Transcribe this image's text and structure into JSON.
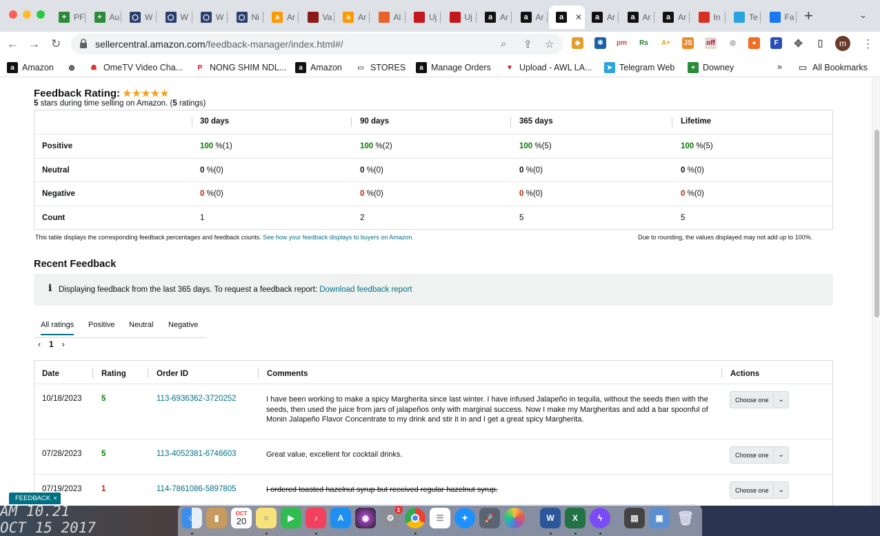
{
  "browser": {
    "tabs": [
      {
        "icon": "green-plus-icon",
        "label": "PF",
        "color": "#2c8a3b"
      },
      {
        "icon": "green-plus-icon",
        "label": "Au",
        "color": "#2c8a3b"
      },
      {
        "icon": "cube-icon",
        "label": "W",
        "color": "#2a3f6e"
      },
      {
        "icon": "cube-icon",
        "label": "W",
        "color": "#2a3f6e"
      },
      {
        "icon": "cube-icon",
        "label": "W",
        "color": "#2a3f6e"
      },
      {
        "icon": "cube-icon",
        "label": "Ni",
        "color": "#2a3f6e"
      },
      {
        "icon": "amazon-icon",
        "label": "Ar",
        "color": "#ff9900"
      },
      {
        "icon": "vv-icon",
        "label": "Va",
        "color": "#8b1a1a"
      },
      {
        "icon": "amazon-icon",
        "label": "Ar",
        "color": "#ff9900"
      },
      {
        "icon": "pen-icon",
        "label": "Al",
        "color": "#e8622c"
      },
      {
        "icon": "v-logo-icon",
        "label": "Uj",
        "color": "#c4161c"
      },
      {
        "icon": "v-logo-icon",
        "label": "Uj",
        "color": "#c4161c"
      },
      {
        "icon": "amazon-a-icon",
        "label": "Ar",
        "color": "#111"
      },
      {
        "icon": "amazon-a-icon",
        "label": "Ar",
        "color": "#111"
      },
      {
        "icon": "amazon-a-icon",
        "label": "",
        "color": "#111",
        "active": true
      },
      {
        "icon": "amazon-a-icon",
        "label": "Ar",
        "color": "#111"
      },
      {
        "icon": "amazon-a-icon",
        "label": "Ar",
        "color": "#111"
      },
      {
        "icon": "amazon-a-icon",
        "label": "Ar",
        "color": "#111"
      },
      {
        "icon": "gmail-icon",
        "label": "In",
        "color": "#d93025"
      },
      {
        "icon": "telegram-icon",
        "label": "Te",
        "color": "#2aa3df"
      },
      {
        "icon": "facebook-icon",
        "label": "Fa",
        "color": "#1877f2"
      }
    ],
    "url_host": "sellercentral.amazon.com",
    "url_path": "/feedback-manager/index.html#/",
    "profile_initial": "m",
    "bookmarks": [
      {
        "label": "Amazon",
        "icon": "amazon-a-icon"
      },
      {
        "label": "",
        "icon": "globe-icon"
      },
      {
        "label": "OmeTV Video Cha...",
        "icon": "ometv-icon"
      },
      {
        "label": "NONG SHIM NDL...",
        "icon": "pinterest-icon"
      },
      {
        "label": "Amazon",
        "icon": "amazon-a-icon"
      },
      {
        "label": "STORES",
        "icon": "folder-icon"
      },
      {
        "label": "Manage Orders",
        "icon": "amazon-a-icon"
      },
      {
        "label": "Upload - AWL LA...",
        "icon": "v-logo-icon"
      },
      {
        "label": "Telegram Web",
        "icon": "telegram-icon"
      },
      {
        "label": "Downey",
        "icon": "green-plus-icon"
      }
    ],
    "bookmarks_overflow": "»",
    "all_bookmarks": "All Bookmarks"
  },
  "feedback_rating": {
    "title": "Feedback Rating:",
    "stars": "★★★★★",
    "summary_count": "5",
    "summary_mid": " stars during time selling on Amazon. (",
    "summary_ratings": "5",
    "summary_end": " ratings)",
    "columns": [
      "30 days",
      "90 days",
      "365 days",
      "Lifetime"
    ],
    "rows": [
      {
        "label": "Positive",
        "kind": "green",
        "cells": [
          [
            "100",
            " %(1)"
          ],
          [
            "100",
            " %(2)"
          ],
          [
            "100",
            " %(5)"
          ],
          [
            "100",
            " %(5)"
          ]
        ]
      },
      {
        "label": "Neutral",
        "kind": "plain",
        "cells": [
          [
            "0",
            " %(0)"
          ],
          [
            "0",
            " %(0)"
          ],
          [
            "0",
            " %(0)"
          ],
          [
            "0",
            " %(0)"
          ]
        ]
      },
      {
        "label": "Negative",
        "kind": "red",
        "cells": [
          [
            "0",
            " %(0)"
          ],
          [
            "0",
            " %(0)"
          ],
          [
            "0",
            " %(0)"
          ],
          [
            "0",
            " %(0)"
          ]
        ]
      },
      {
        "label": "Count",
        "kind": "count",
        "cells": [
          [
            "1",
            ""
          ],
          [
            "2",
            ""
          ],
          [
            "5",
            ""
          ],
          [
            "5",
            ""
          ]
        ]
      }
    ],
    "footnote": "This table displays the corresponding feedback percentages and feedback counts.",
    "footnote_link": "See how your feedback displays to buyers on Amazon.",
    "rounding_note": "Due to rounding, the values displayed may not add up to 100%."
  },
  "recent_feedback": {
    "title": "Recent Feedback",
    "info_text": "Displaying feedback from the last 365 days. To request a feedback report:",
    "info_link": "Download feedback report",
    "tabs": [
      "All ratings",
      "Positive",
      "Neutral",
      "Negative"
    ],
    "page": "1",
    "columns": [
      "Date",
      "Rating",
      "Order ID",
      "Comments",
      "Actions"
    ],
    "rows": [
      {
        "date": "10/18/2023",
        "rating": "5",
        "order_id": "113-6936362-3720252",
        "comment": "I have been working to make a spicy Margherita since last winter. I have infused Jalapeño in tequila, without the seeds then with the seeds, then used the juice from jars of jalapeños only with marginal success. Now I make my Margheritas and add a bar spoonful of Monin Jalapeño Flavor Concentrate to my drink and stir it in and I get a great spicy Margherita.",
        "action": "Choose one"
      },
      {
        "date": "07/28/2023",
        "rating": "5",
        "order_id": "113-4052381-6746603",
        "comment": "Great value, excellent for cocktail drinks.",
        "action": "Choose one"
      },
      {
        "date": "07/19/2023",
        "rating": "1",
        "order_id": "114-7861086-5897805",
        "comment": "I ordered toasted hazelnut syrup but received regular hazelnut syrup.",
        "action": "Choose one"
      }
    ]
  },
  "feedback_pill": {
    "label": "FEEDBACK",
    "close": "×"
  },
  "desktop": {
    "line1": "AM 10.21",
    "line2": "OCT 15 2017"
  },
  "dock": {
    "calendar_month": "OCT",
    "calendar_day": "20",
    "settings_badge": "1"
  }
}
